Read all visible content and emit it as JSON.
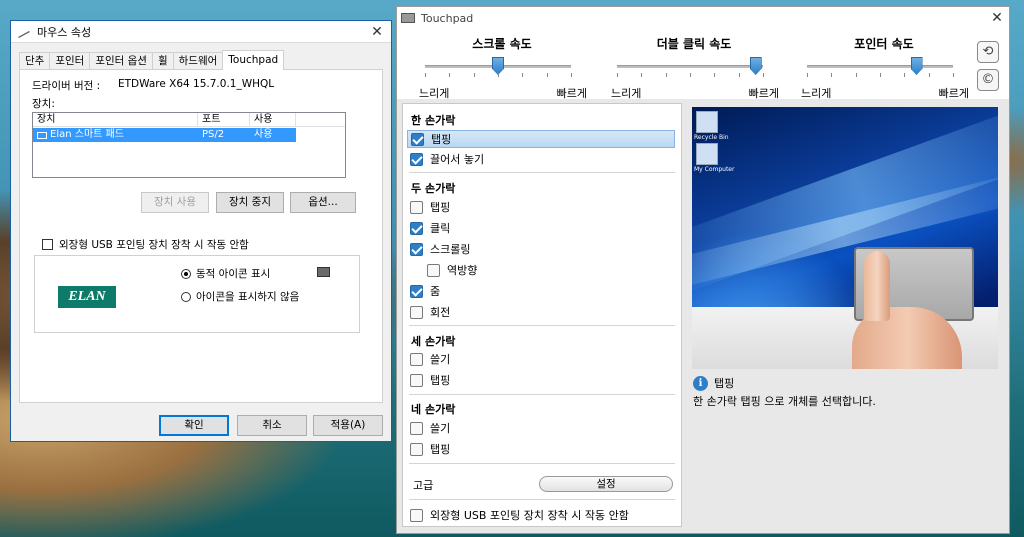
{
  "mouse": {
    "title": "마우스 속성",
    "tabs": [
      "단추",
      "포인터",
      "포인터 옵션",
      "휠",
      "하드웨어",
      "Touchpad"
    ],
    "driver_label": "드라이버 버전 :",
    "driver_value": "ETDWare X64 15.7.0.1_WHQL",
    "device_label": "장치:",
    "columns": [
      "장치",
      "포트",
      "사용"
    ],
    "row": {
      "device": "Elan 스마트 패드",
      "port": "PS/2",
      "use": "사용"
    },
    "btn_enable": "장치 사용",
    "btn_disable": "장치 중지",
    "btn_options": "옵션...",
    "usb_checkbox": "외장형 USB 포인팅 장치 장착 시 작동 안함",
    "logo_text": "ELAN",
    "radio_show": "동적 아이콘 표시",
    "radio_hide": "아이콘을 표시하지 않음",
    "ok": "확인",
    "cancel": "취소",
    "apply": "적용(A)"
  },
  "touchpad": {
    "title": "Touchpad",
    "sliders": [
      {
        "title": "스크롤 속도",
        "low": "느리게",
        "high": "빠르게",
        "value": 0.5
      },
      {
        "title": "더블 클릭 속도",
        "low": "느리게",
        "high": "빠르게",
        "value": 0.95
      },
      {
        "title": "포인터 속도",
        "low": "느리게",
        "high": "빠르게",
        "value": 0.75
      }
    ],
    "reset_icon": "reset-icon",
    "copyright_icon": "copyright-icon",
    "one_finger": {
      "title": "한 손가락",
      "tapping": "탭핑",
      "drag": "끌어서 놓기"
    },
    "two_finger": {
      "title": "두 손가락",
      "tapping": "탭핑",
      "click": "클릭",
      "scrolling": "스크롤링",
      "reverse": "역방향",
      "zoom": "줌",
      "rotate": "회전"
    },
    "three_finger": {
      "title": "세 손가락",
      "swipe": "쓸기",
      "tapping": "탭핑"
    },
    "four_finger": {
      "title": "네 손가락",
      "swipe": "쓸기",
      "tapping": "탭핑"
    },
    "advanced_label": "고급",
    "settings_btn": "설정",
    "usb_checkbox": "외장형 USB 포인팅 장치 장착 시 작동 안함",
    "info_title": "탭핑",
    "info_desc": "한 손가락 탭핑 으로 개체를 선택합니다.",
    "desktop_icons": [
      "Recycle Bin",
      "My Computer"
    ]
  }
}
